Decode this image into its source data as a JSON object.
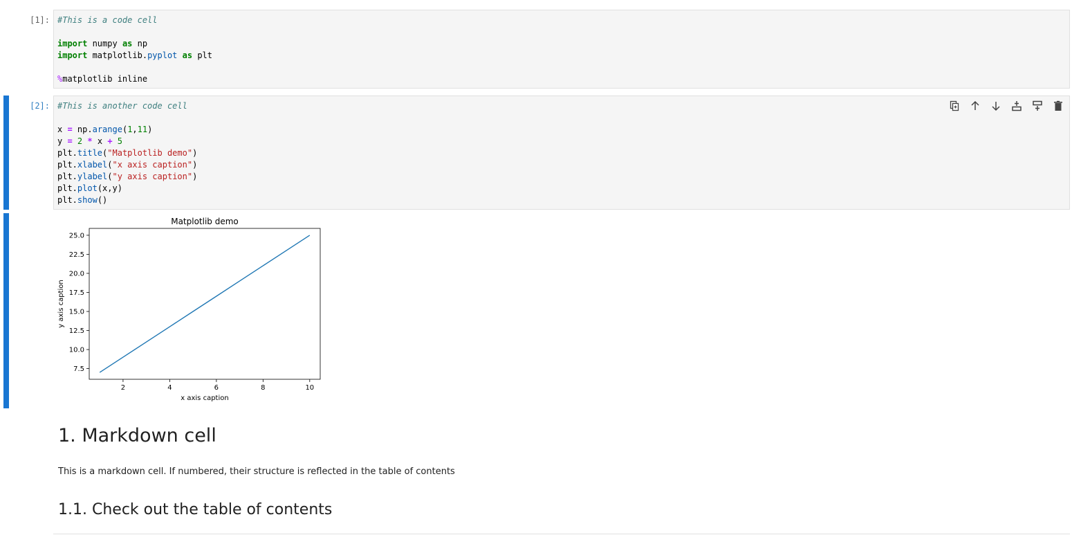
{
  "cells": [
    {
      "prompt": "[1]:",
      "lines": [
        [
          {
            "t": "#This is a code cell",
            "c": "cm-comment"
          }
        ],
        [],
        [
          {
            "t": "import",
            "c": "cm-keyword"
          },
          {
            "t": " numpy "
          },
          {
            "t": "as",
            "c": "cm-keyword"
          },
          {
            "t": " np"
          }
        ],
        [
          {
            "t": "import",
            "c": "cm-keyword"
          },
          {
            "t": " matplotlib."
          },
          {
            "t": "pyplot",
            "c": "cm-prop"
          },
          {
            "t": " "
          },
          {
            "t": "as",
            "c": "cm-keyword"
          },
          {
            "t": " plt"
          }
        ],
        [],
        [
          {
            "t": "%",
            "c": "cm-magic"
          },
          {
            "t": "matplotlib inline"
          }
        ]
      ]
    },
    {
      "prompt": "[2]:",
      "lines": [
        [
          {
            "t": "#This is another code cell",
            "c": "cm-comment"
          }
        ],
        [],
        [
          {
            "t": "x "
          },
          {
            "t": "=",
            "c": "cm-operator"
          },
          {
            "t": " np."
          },
          {
            "t": "arange",
            "c": "cm-prop"
          },
          {
            "t": "("
          },
          {
            "t": "1",
            "c": "cm-number"
          },
          {
            "t": ","
          },
          {
            "t": "11",
            "c": "cm-number"
          },
          {
            "t": ")"
          }
        ],
        [
          {
            "t": "y "
          },
          {
            "t": "=",
            "c": "cm-operator"
          },
          {
            "t": " "
          },
          {
            "t": "2",
            "c": "cm-number"
          },
          {
            "t": " "
          },
          {
            "t": "*",
            "c": "cm-operator"
          },
          {
            "t": " x "
          },
          {
            "t": "+",
            "c": "cm-operator"
          },
          {
            "t": " "
          },
          {
            "t": "5",
            "c": "cm-number"
          }
        ],
        [
          {
            "t": "plt."
          },
          {
            "t": "title",
            "c": "cm-prop"
          },
          {
            "t": "("
          },
          {
            "t": "\"Matplotlib demo\"",
            "c": "cm-string"
          },
          {
            "t": ")"
          }
        ],
        [
          {
            "t": "plt."
          },
          {
            "t": "xlabel",
            "c": "cm-prop"
          },
          {
            "t": "("
          },
          {
            "t": "\"x axis caption\"",
            "c": "cm-string"
          },
          {
            "t": ")"
          }
        ],
        [
          {
            "t": "plt."
          },
          {
            "t": "ylabel",
            "c": "cm-prop"
          },
          {
            "t": "("
          },
          {
            "t": "\"y axis caption\"",
            "c": "cm-string"
          },
          {
            "t": ")"
          }
        ],
        [
          {
            "t": "plt."
          },
          {
            "t": "plot",
            "c": "cm-prop"
          },
          {
            "t": "(x,y)"
          }
        ],
        [
          {
            "t": "plt."
          },
          {
            "t": "show",
            "c": "cm-prop"
          },
          {
            "t": "()"
          }
        ]
      ]
    }
  ],
  "toolbar": [
    {
      "name": "duplicate-cell-icon"
    },
    {
      "name": "move-cell-up-icon"
    },
    {
      "name": "move-cell-down-icon"
    },
    {
      "name": "insert-cell-above-icon"
    },
    {
      "name": "insert-cell-below-icon"
    },
    {
      "name": "delete-cell-icon"
    }
  ],
  "colors": {
    "accent": "#1976d2",
    "line": "#1f77b4"
  },
  "chart_data": {
    "type": "line",
    "title": "Matplotlib demo",
    "xlabel": "x axis caption",
    "ylabel": "y axis caption",
    "x": [
      1,
      2,
      3,
      4,
      5,
      6,
      7,
      8,
      9,
      10
    ],
    "series": [
      {
        "values": [
          7,
          9,
          11,
          13,
          15,
          17,
          19,
          21,
          23,
          25
        ]
      }
    ],
    "xticks": [
      "2",
      "4",
      "6",
      "8",
      "10"
    ],
    "yticks": [
      "7.5",
      "10.0",
      "12.5",
      "15.0",
      "17.5",
      "20.0",
      "22.5",
      "25.0"
    ],
    "xlim": [
      0.55,
      10.45
    ],
    "ylim": [
      6.1,
      25.9
    ],
    "grid": false
  },
  "markdown": {
    "h1": "1. Markdown cell",
    "p": "This is a markdown cell. If numbered, their structure is reflected in the table of contents",
    "h2": "1.1. Check out the table of contents"
  }
}
